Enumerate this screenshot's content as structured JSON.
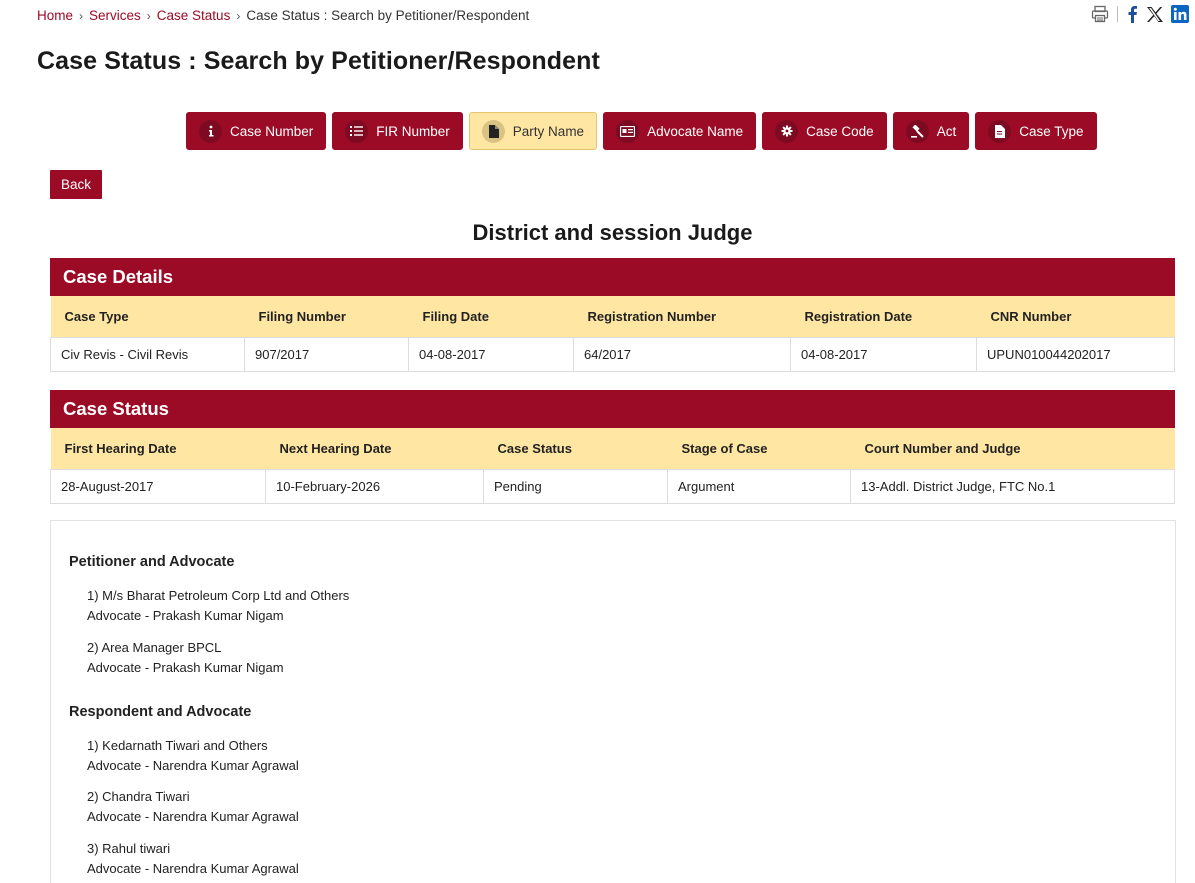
{
  "breadcrumb": {
    "home": "Home",
    "services": "Services",
    "case_status": "Case Status",
    "current": "Case Status : Search by Petitioner/Respondent",
    "sep": "›"
  },
  "page_title": "Case Status : Search by Petitioner/Respondent",
  "tabs": [
    {
      "label": "Case Number",
      "icon": "info-icon"
    },
    {
      "label": "FIR Number",
      "icon": "list-icon"
    },
    {
      "label": "Party Name",
      "icon": "document-icon",
      "active": true
    },
    {
      "label": "Advocate Name",
      "icon": "id-card-icon"
    },
    {
      "label": "Case Code",
      "icon": "gear-icon"
    },
    {
      "label": "Act",
      "icon": "gavel-icon"
    },
    {
      "label": "Case Type",
      "icon": "file-icon"
    }
  ],
  "back_label": "Back",
  "court_title": "District and session Judge",
  "case_details": {
    "title": "Case Details",
    "headers": [
      "Case Type",
      "Filing Number",
      "Filing Date",
      "Registration Number",
      "Registration Date",
      "CNR Number"
    ],
    "row": [
      "Civ Revis - Civil Revis",
      "907/2017",
      "04-08-2017",
      "64/2017",
      "04-08-2017",
      "UPUN010044202017"
    ]
  },
  "case_status": {
    "title": "Case Status",
    "headers": [
      "First Hearing Date",
      "Next Hearing Date",
      "Case Status",
      "Stage of Case",
      "Court Number and Judge"
    ],
    "row": [
      "28-August-2017",
      "10-February-2026",
      "Pending",
      "Argument",
      "13-Addl. District Judge, FTC No.1"
    ]
  },
  "petitioners": {
    "title": "Petitioner and Advocate",
    "items": [
      {
        "name": "1) M/s Bharat Petroleum Corp Ltd and Others",
        "advocate": "Advocate - Prakash Kumar Nigam"
      },
      {
        "name": "2) Area Manager BPCL",
        "advocate": "Advocate - Prakash Kumar Nigam"
      }
    ]
  },
  "respondents": {
    "title": "Respondent and Advocate",
    "items": [
      {
        "name": "1) Kedarnath Tiwari and Others",
        "advocate": "Advocate - Narendra Kumar Agrawal"
      },
      {
        "name": "2) Chandra Tiwari",
        "advocate": "Advocate - Narendra Kumar Agrawal"
      },
      {
        "name": "3) Rahul tiwari",
        "advocate": "Advocate - Narendra Kumar Agrawal"
      }
    ]
  },
  "share_icons": [
    "print-icon",
    "facebook-icon",
    "x-icon",
    "linkedin-icon"
  ],
  "colors": {
    "brand": "#9b0b26",
    "header_fill": "#ffe7a3",
    "active_tab": "#ffe7a3",
    "linkedin": "#0a66c2",
    "facebook": "#1877f2"
  }
}
